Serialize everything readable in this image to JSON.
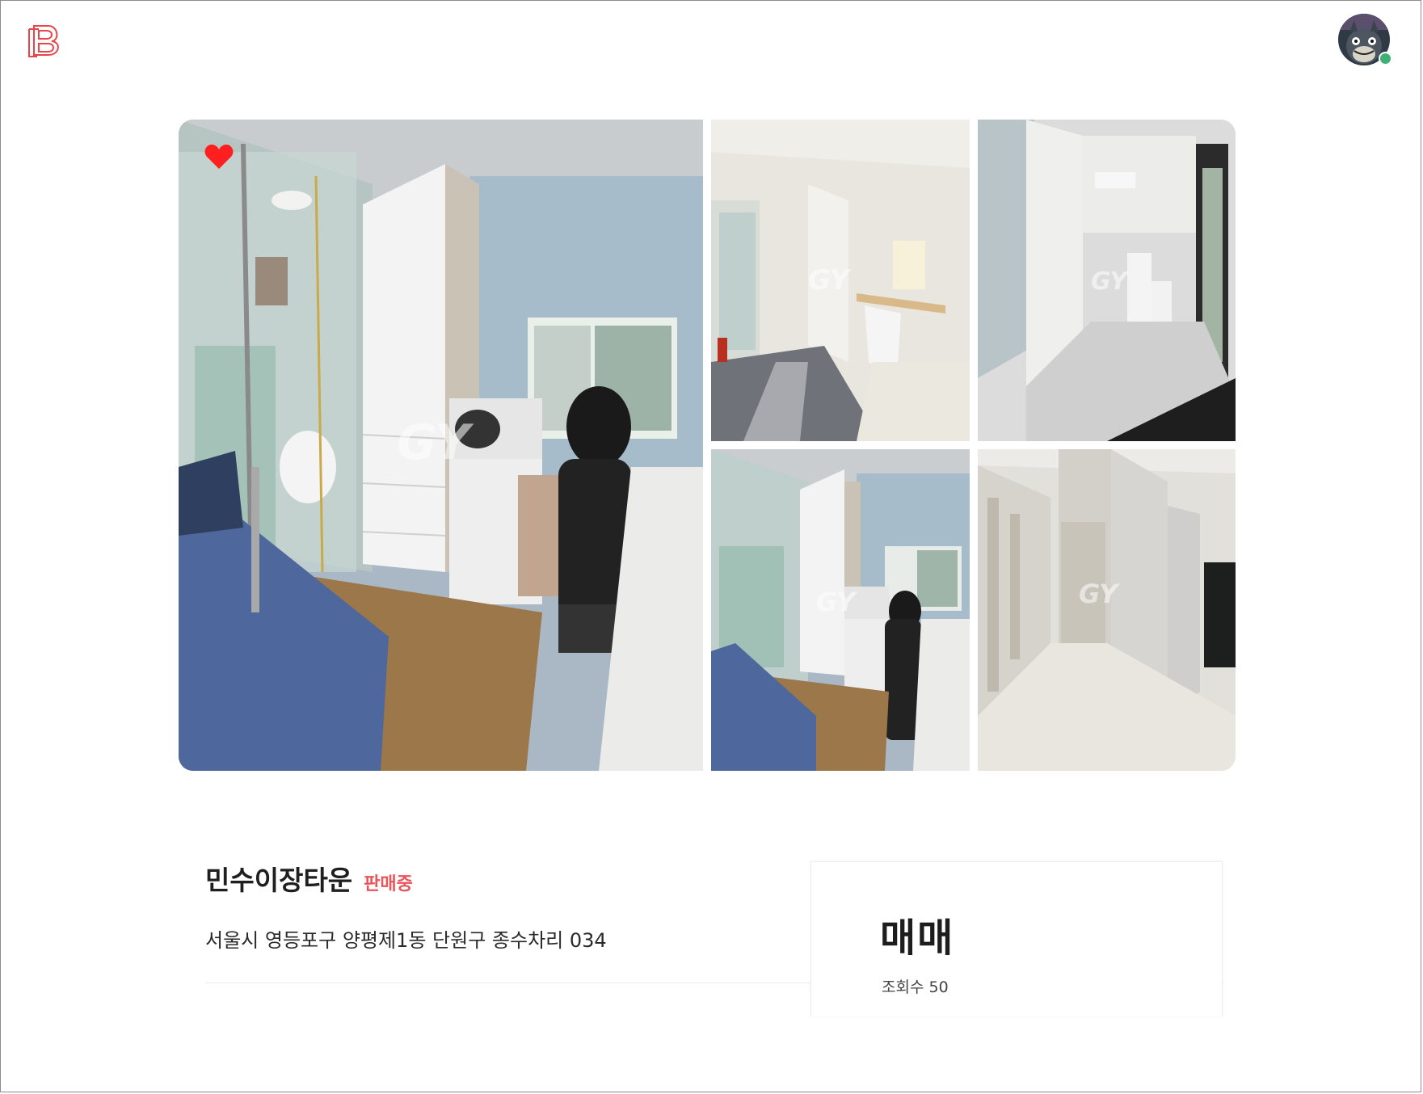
{
  "header": {
    "logo_icon": "brand-logo-icon",
    "avatar_icon": "user-avatar",
    "online_status_color": "#3bb273"
  },
  "gallery": {
    "photos": [
      {
        "name": "room-photo-main",
        "label": "bedroom with bathroom and wardrobe"
      },
      {
        "name": "room-photo-2",
        "label": "room with desk and rug"
      },
      {
        "name": "room-photo-3",
        "label": "room with refrigerator and washer"
      },
      {
        "name": "room-photo-4",
        "label": "bedroom wide view"
      },
      {
        "name": "room-photo-5",
        "label": "hallway"
      }
    ],
    "favorite_icon": "heart-icon",
    "favorite_color": "#ff1f1f"
  },
  "listing": {
    "title": "민수이장타운",
    "status": "판매중",
    "status_color": "#e8555a",
    "address": "서울시 영등포구 양평제1동 단원구 종수차리 034"
  },
  "card": {
    "deal_type": "매매",
    "views_label": "조회수 50"
  },
  "colors": {
    "brand": "#e8454a",
    "accent": "#e8555a"
  }
}
